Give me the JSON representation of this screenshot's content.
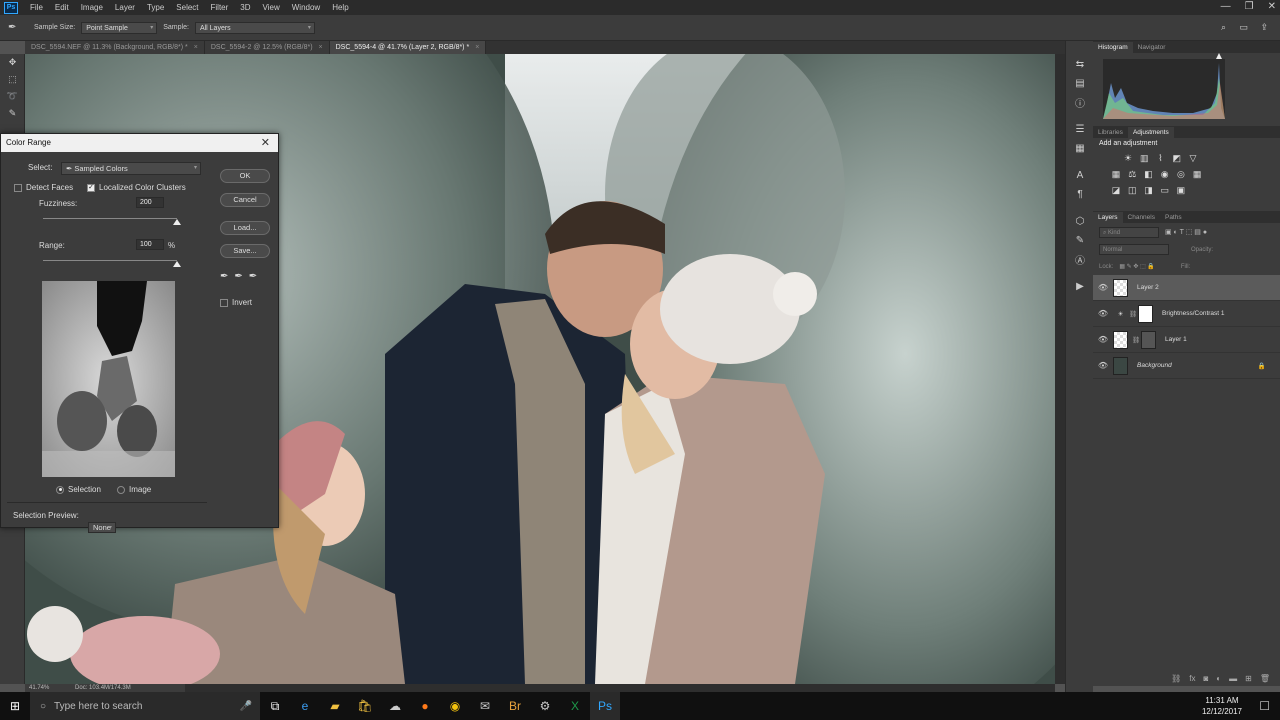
{
  "app": {
    "logo": "Ps",
    "menu": [
      "File",
      "Edit",
      "Image",
      "Layer",
      "Type",
      "Select",
      "Filter",
      "3D",
      "View",
      "Window",
      "Help"
    ]
  },
  "options_bar": {
    "sample_size_label": "Sample Size:",
    "sample_size_value": "Point Sample",
    "sample_label": "Sample:",
    "sample_value": "All Layers"
  },
  "document_tabs": [
    {
      "label": "DSC_5594.NEF @ 11.3% (Background, RGB/8*) *",
      "active": false
    },
    {
      "label": "DSC_5594-2 @ 12.5% (RGB/8*)",
      "active": false
    },
    {
      "label": "DSC_5594-4 @ 41.7% (Layer 2, RGB/8*) *",
      "active": true
    }
  ],
  "status": {
    "zoom": "41.74%",
    "doc": "Doc: 103.4M/174.3M"
  },
  "dialog": {
    "title": "Color Range",
    "select_label": "Select:",
    "select_value": "Sampled Colors",
    "detect_faces": "Detect Faces",
    "localized": "Localized Color Clusters",
    "fuzziness_label": "Fuzziness:",
    "fuzziness_value": "200",
    "fuzziness_level": 1.0,
    "range_label": "Range:",
    "range_value": "100",
    "range_unit": "%",
    "range_level": 1.0,
    "ok": "OK",
    "cancel": "Cancel",
    "load": "Load...",
    "save": "Save...",
    "invert": "Invert",
    "selection": "Selection",
    "image": "Image",
    "preview_label": "Selection Preview:",
    "preview_value": "None"
  },
  "panels": {
    "histogram_tabs": [
      "Histogram",
      "Navigator"
    ],
    "adjust_tabs": [
      "Libraries",
      "Adjustments"
    ],
    "add_adjustment": "Add an adjustment",
    "layers_tabs": [
      "Layers",
      "Channels",
      "Paths"
    ],
    "kind_placeholder": "Kind",
    "blend_mode": "Normal",
    "opacity_label": "Opacity:",
    "lock_label": "Lock:",
    "fill_label": "Fill:",
    "layers": [
      {
        "name": "Layer 2",
        "selected": true
      },
      {
        "name": "Brightness/Contrast 1",
        "selected": false
      },
      {
        "name": "Layer 1",
        "selected": false
      },
      {
        "name": "Background",
        "selected": false
      }
    ]
  },
  "taskbar": {
    "search_placeholder": "Type here to search",
    "time": "11:31 AM",
    "date": "12/12/2017"
  },
  "colors": {
    "accent": "#31a8ff",
    "panel": "#3c3c3c",
    "background": "#535353"
  }
}
